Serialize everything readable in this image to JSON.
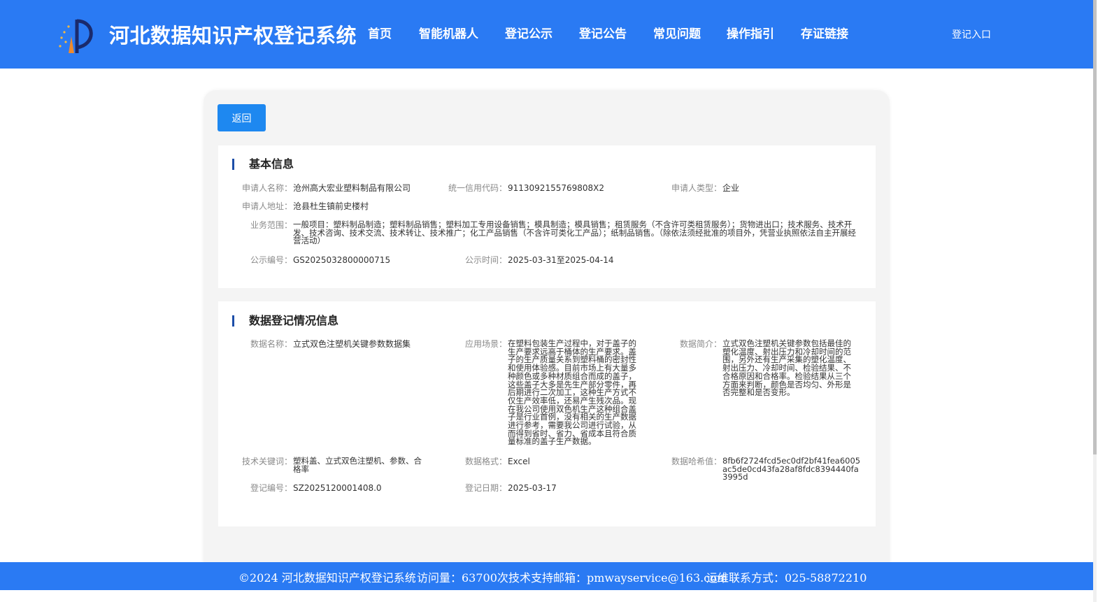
{
  "header": {
    "site_title": "河北数据知识产权登记系统",
    "nav": [
      "首页",
      "智能机器人",
      "登记公示",
      "登记公告",
      "常见问题",
      "操作指引",
      "存证链接"
    ],
    "login_label": "登记入口",
    "brand_color": "#2a7af3"
  },
  "toolbar": {
    "back_label": "返回"
  },
  "basic_info": {
    "title": "基本信息",
    "applicant_name_label": "申请人名称：",
    "applicant_name": "沧州高大宏业塑料制品有限公司",
    "credit_code_label": "统一信用代码：",
    "credit_code": "9113092155769808X2",
    "applicant_type_label": "申请人类型：",
    "applicant_type": "企业",
    "address_label": "申请人地址：",
    "address": "沧县杜生镇前史楼村",
    "scope_label": "业务范围：",
    "scope": "一般项目：塑料制品制造；塑料制品销售；塑料加工专用设备销售；模具制造；模具销售；租赁服务（不含许可类租赁服务）；货物进出口；技术服务、技术开发、技术咨询、技术交流、技术转让、技术推广；化工产品销售（不含许可类化工产品）；纸制品销售。（除依法须经批准的项目外，凭营业执照依法自主开展经营活动）",
    "notice_no_label": "公示编号：",
    "notice_no": "GS2025032800000715",
    "notice_time_label": "公示时间：",
    "notice_time": "2025-03-31至2025-04-14"
  },
  "data_info": {
    "title": "数据登记情况信息",
    "data_name_label": "数据名称：",
    "data_name": "立式双色注塑机关键参数数据集",
    "scenario_label": "应用场景：",
    "scenario": "在塑料包装生产过程中，对于盖子的生产要求远高于桶体的生产要求。盖子的生产质量关系到塑料桶的密封性和使用体验感。目前市场上有大量多种颜色或多种材质组合而成的盖子，这些盖子大多是先生产部分零件，再后期进行二次加工，这种生产方式不仅生产效率低，还易产生残次品。现在我公司使用双色机生产这种组合盖子是行业首例，没有相关的生产数据进行参考，需要我公司进行试验，从而得到省时、省力、省成本且符合质量标准的盖子生产数据。",
    "intro_label": "数据简介：",
    "intro": "立式双色注塑机关键参数包括最佳的塑化温度、射出压力和冷却时间的范围，另外还有生产采集的塑化温度、射出压力、冷却时间、检验结果、不合格原因和合格率。检验结果从三个方面来判断，颜色是否均匀、外形是否完整和是否变形。",
    "keywords_label": "技术关键词：",
    "keywords": "塑料盖、立式双色注塑机、参数、合格率",
    "format_label": "数据格式：",
    "format": "Excel",
    "hash_label": "数据哈希值：",
    "hash": "8fb6f2724fcd5ec0df2bf41fea6005ac5de0cd43fa28af8fdc8394440fa3995d",
    "reg_no_label": "登记编号：",
    "reg_no": "SZ2025120001408.0",
    "reg_date_label": "登记日期：",
    "reg_date": "2025-03-17"
  },
  "footer": {
    "copyright": "©2024 河北数据知识产权登记系统",
    "visits": "访问量：63700次",
    "email": "技术支持邮箱：pmwayservice@163.com",
    "phone": "运维联系方式：025-58872210"
  }
}
